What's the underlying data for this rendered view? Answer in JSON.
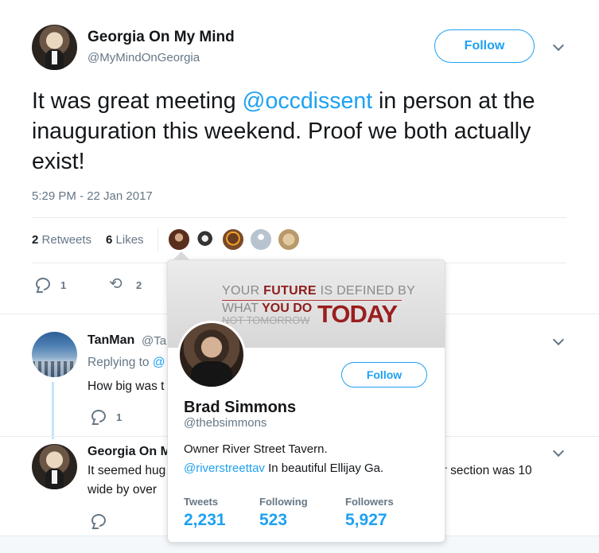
{
  "tweet": {
    "author_name": "Georgia On My Mind",
    "author_handle": "@MyMindOnGeorgia",
    "follow_label": "Follow",
    "text_before": "It was great meeting ",
    "mention": "@occdissent",
    "text_after": " in person at the inauguration this weekend.  Proof we both actually exist!",
    "timestamp": "5:29 PM - 22 Jan 2017",
    "retweets_count": "2",
    "retweets_label": "Retweets",
    "likes_count": "6",
    "likes_label": "Likes",
    "reply_count": "1",
    "retweet_action_count": "2"
  },
  "replies": [
    {
      "author_name": "TanMan",
      "author_handle": "@Ta",
      "replying_to_label": "Replying to",
      "replying_to_handle": "@",
      "text": "How big was t",
      "reply_count": "1"
    },
    {
      "author_name": "Georgia On M",
      "text_line1_left": "It seemed hug",
      "text_line1_right": "er section was 10",
      "text_line2": "wide by over"
    }
  ],
  "hovercard": {
    "banner": {
      "line1_pre": "YOUR ",
      "line1_em": "FUTURE",
      "line1_post": " IS DEFINED BY",
      "line2_pre": "WHAT ",
      "line2_em": "YOU DO",
      "line3": "NOT TOMORROW",
      "big_word": "TODAY"
    },
    "follow_label": "Follow",
    "name": "Brad Simmons",
    "handle": "@thebsimmons",
    "bio_line1": "Owner River Street Tavern.",
    "bio_link": "@riverstreettav",
    "bio_after": " In beautiful Ellijay Ga.",
    "stats": [
      {
        "label": "Tweets",
        "value": "2,231"
      },
      {
        "label": "Following",
        "value": "523"
      },
      {
        "label": "Followers",
        "value": "5,927"
      }
    ]
  },
  "colors": {
    "accent": "#1da1f2",
    "text": "#14171a",
    "muted": "#657786"
  }
}
